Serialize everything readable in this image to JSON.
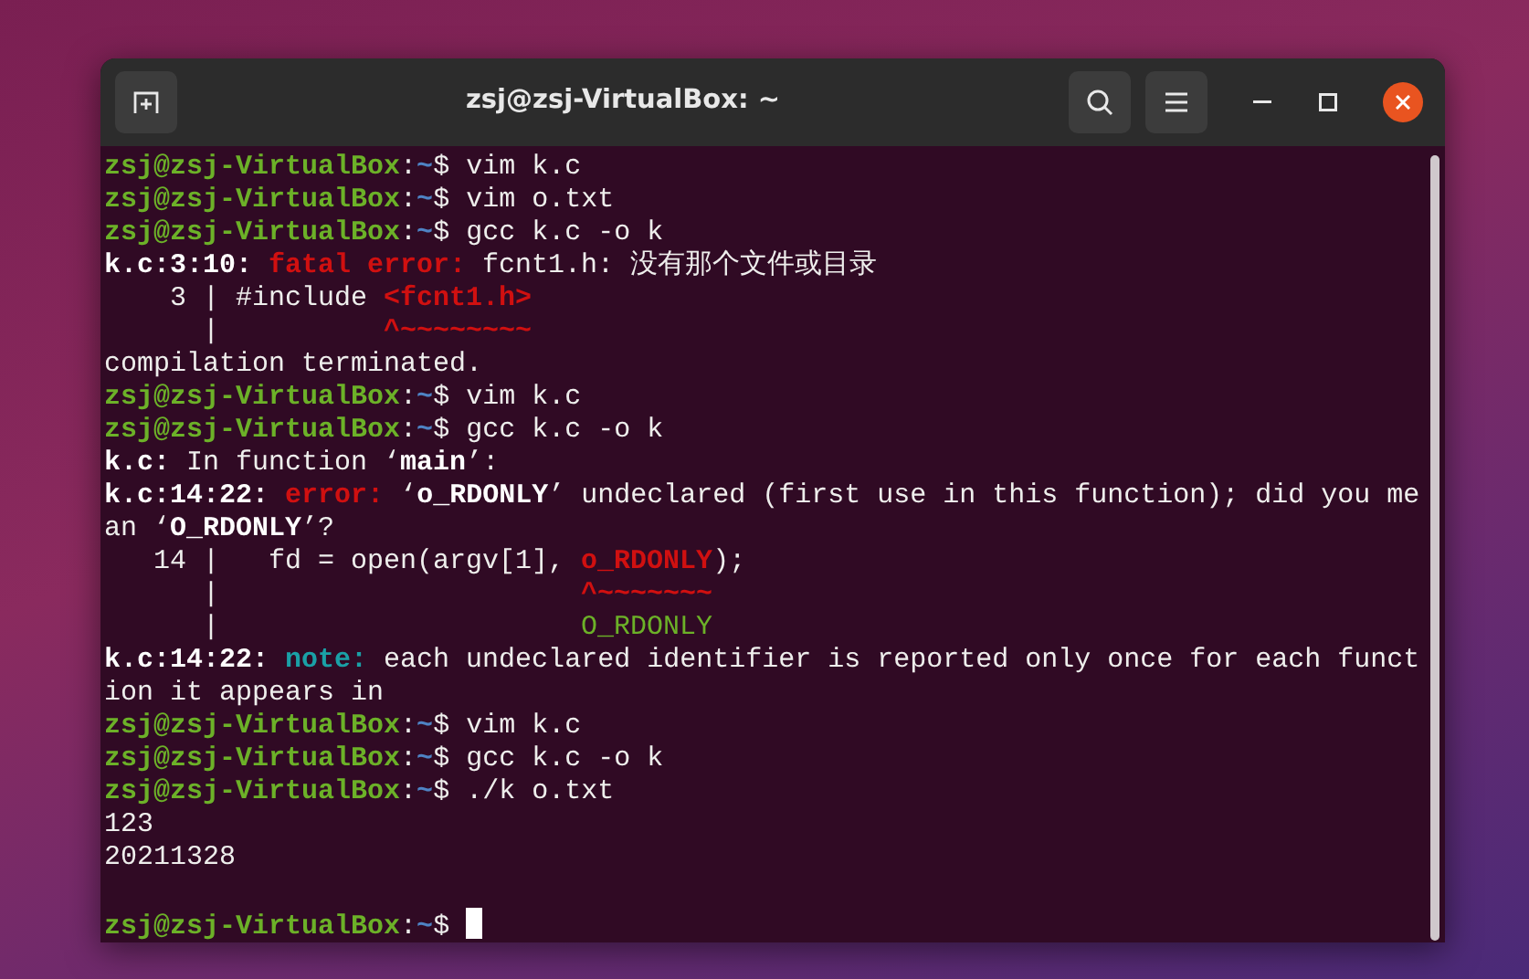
{
  "window": {
    "title": "zsj@zsj-VirtualBox: ~"
  },
  "terminal": {
    "lines": [
      {
        "kind": "prompt",
        "segments": [
          {
            "kind": "user",
            "text": "zsj@zsj-VirtualBox"
          },
          {
            "kind": "plain",
            "text": ":"
          },
          {
            "kind": "path",
            "text": "~"
          },
          {
            "kind": "plain",
            "text": "$ vim k.c"
          }
        ]
      },
      {
        "kind": "prompt",
        "segments": [
          {
            "kind": "user",
            "text": "zsj@zsj-VirtualBox"
          },
          {
            "kind": "plain",
            "text": ":"
          },
          {
            "kind": "path",
            "text": "~"
          },
          {
            "kind": "plain",
            "text": "$ vim o.txt"
          }
        ]
      },
      {
        "kind": "prompt",
        "segments": [
          {
            "kind": "user",
            "text": "zsj@zsj-VirtualBox"
          },
          {
            "kind": "plain",
            "text": ":"
          },
          {
            "kind": "path",
            "text": "~"
          },
          {
            "kind": "plain",
            "text": "$ gcc k.c -o k"
          }
        ]
      },
      {
        "kind": "output",
        "segments": [
          {
            "kind": "bold",
            "text": "k.c:3:10: "
          },
          {
            "kind": "error",
            "text": "fatal error: "
          },
          {
            "kind": "plain",
            "text": "fcnt1.h: 没有那个文件或目录"
          }
        ]
      },
      {
        "kind": "output",
        "segments": [
          {
            "kind": "plain",
            "text": "    3 | #include "
          },
          {
            "kind": "error",
            "text": "<fcnt1.h>"
          }
        ]
      },
      {
        "kind": "output",
        "segments": [
          {
            "kind": "plain",
            "text": "      |          "
          },
          {
            "kind": "error",
            "text": "^~~~~~~~~"
          }
        ]
      },
      {
        "kind": "output",
        "segments": [
          {
            "kind": "plain",
            "text": "compilation terminated."
          }
        ]
      },
      {
        "kind": "prompt",
        "segments": [
          {
            "kind": "user",
            "text": "zsj@zsj-VirtualBox"
          },
          {
            "kind": "plain",
            "text": ":"
          },
          {
            "kind": "path",
            "text": "~"
          },
          {
            "kind": "plain",
            "text": "$ vim k.c"
          }
        ]
      },
      {
        "kind": "prompt",
        "segments": [
          {
            "kind": "user",
            "text": "zsj@zsj-VirtualBox"
          },
          {
            "kind": "plain",
            "text": ":"
          },
          {
            "kind": "path",
            "text": "~"
          },
          {
            "kind": "plain",
            "text": "$ gcc k.c -o k"
          }
        ]
      },
      {
        "kind": "output",
        "segments": [
          {
            "kind": "bold",
            "text": "k.c:"
          },
          {
            "kind": "plain",
            "text": " In function ‘"
          },
          {
            "kind": "bold",
            "text": "main"
          },
          {
            "kind": "plain",
            "text": "’:"
          }
        ]
      },
      {
        "kind": "output",
        "segments": [
          {
            "kind": "bold",
            "text": "k.c:14:22: "
          },
          {
            "kind": "error",
            "text": "error: "
          },
          {
            "kind": "plain",
            "text": "‘"
          },
          {
            "kind": "bold",
            "text": "o_RDONLY"
          },
          {
            "kind": "plain",
            "text": "’ undeclared (first use in this function); did you me"
          }
        ]
      },
      {
        "kind": "output",
        "segments": [
          {
            "kind": "plain",
            "text": "an ‘"
          },
          {
            "kind": "bold",
            "text": "O_RDONLY"
          },
          {
            "kind": "plain",
            "text": "’?"
          }
        ]
      },
      {
        "kind": "output",
        "segments": [
          {
            "kind": "plain",
            "text": "   14 |   fd = open(argv[1], "
          },
          {
            "kind": "error",
            "text": "o_RDONLY"
          },
          {
            "kind": "plain",
            "text": ");"
          }
        ]
      },
      {
        "kind": "output",
        "segments": [
          {
            "kind": "plain",
            "text": "      |                      "
          },
          {
            "kind": "error",
            "text": "^~~~~~~~"
          }
        ]
      },
      {
        "kind": "output",
        "segments": [
          {
            "kind": "plain",
            "text": "      |                      "
          },
          {
            "kind": "fixit",
            "text": "O_RDONLY"
          }
        ]
      },
      {
        "kind": "output",
        "segments": [
          {
            "kind": "bold",
            "text": "k.c:14:22: "
          },
          {
            "kind": "note",
            "text": "note: "
          },
          {
            "kind": "plain",
            "text": "each undeclared identifier is reported only once for each funct"
          }
        ]
      },
      {
        "kind": "output",
        "segments": [
          {
            "kind": "plain",
            "text": "ion it appears in"
          }
        ]
      },
      {
        "kind": "prompt",
        "segments": [
          {
            "kind": "user",
            "text": "zsj@zsj-VirtualBox"
          },
          {
            "kind": "plain",
            "text": ":"
          },
          {
            "kind": "path",
            "text": "~"
          },
          {
            "kind": "plain",
            "text": "$ vim k.c"
          }
        ]
      },
      {
        "kind": "prompt",
        "segments": [
          {
            "kind": "user",
            "text": "zsj@zsj-VirtualBox"
          },
          {
            "kind": "plain",
            "text": ":"
          },
          {
            "kind": "path",
            "text": "~"
          },
          {
            "kind": "plain",
            "text": "$ gcc k.c -o k"
          }
        ]
      },
      {
        "kind": "prompt",
        "segments": [
          {
            "kind": "user",
            "text": "zsj@zsj-VirtualBox"
          },
          {
            "kind": "plain",
            "text": ":"
          },
          {
            "kind": "path",
            "text": "~"
          },
          {
            "kind": "plain",
            "text": "$ ./k o.txt"
          }
        ]
      },
      {
        "kind": "output",
        "segments": [
          {
            "kind": "plain",
            "text": "123"
          }
        ]
      },
      {
        "kind": "output",
        "segments": [
          {
            "kind": "plain",
            "text": "20211328"
          }
        ]
      },
      {
        "kind": "blank"
      },
      {
        "kind": "prompt",
        "cursor": true,
        "segments": [
          {
            "kind": "user",
            "text": "zsj@zsj-VirtualBox"
          },
          {
            "kind": "plain",
            "text": ":"
          },
          {
            "kind": "path",
            "text": "~"
          },
          {
            "kind": "plain",
            "text": "$"
          }
        ]
      }
    ]
  }
}
